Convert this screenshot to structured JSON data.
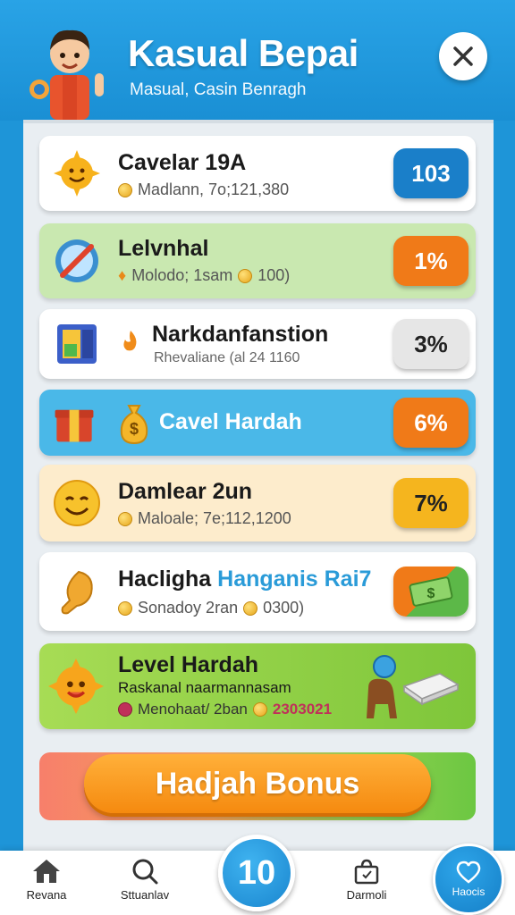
{
  "header": {
    "title": "Kasual Bepai",
    "subtitle": "Masual, Casin Benragh",
    "close_icon": "close-icon"
  },
  "rows": [
    {
      "title": "Cavelar 19A",
      "sub": "Madlann, 7o;121,380",
      "badge": "103",
      "badge_color": "#1a7fc9",
      "bg": "#ffffff",
      "icon": "smiling-sun-icon"
    },
    {
      "title": "Lelvnhal",
      "sub": "Molodo; 1sam",
      "sub2": "100)",
      "badge": "1%",
      "badge_color": "#f07a18",
      "bg": "#c9e8b0",
      "icon": "crossed-compass-icon"
    },
    {
      "title": "Narkdanfanstion",
      "sub": "Rhevaliane (al 24 1160",
      "badge": "3%",
      "badge_color": "#e6e6e6",
      "bg": "#ffffff",
      "icon": "window-frame-icon"
    },
    {
      "title": "Cavel Hardah",
      "badge": "6%",
      "badge_color": "#f07a18",
      "bg": "#4ab8e8",
      "icon": "gift-box-icon"
    },
    {
      "title": "Damlear 2un",
      "sub": "Maloale; 7e;112,1200",
      "badge": "7%",
      "badge_color": "#f5b51e",
      "bg": "#fdeccc",
      "icon": "smiley-face-icon"
    },
    {
      "title": "Hacligha",
      "title_accent": "Hanganis Rai7",
      "sub": "Sonadoy 2ran",
      "sub2": "0300)",
      "bg": "#ffffff",
      "icon": "chicken-leg-icon",
      "badge_icon": "cash-bundle-icon"
    },
    {
      "title": "Level Hardah",
      "sub": "Raskanal naarmannasam",
      "sub3": "Menohaat/ 2ban",
      "sub4": "2303021",
      "bg": "#9ed84e",
      "icon": "sun-face-icon"
    }
  ],
  "bonus_button": "Hadjah Bonus",
  "nav": {
    "items": [
      {
        "label": "Revana",
        "icon": "home-icon"
      },
      {
        "label": "Sttuanlav",
        "icon": "search-icon"
      },
      {
        "label": "Darmoli",
        "icon": "bag-icon"
      },
      {
        "label": "Haocis",
        "icon": "heart-icon"
      }
    ],
    "center_value": "10"
  },
  "colors": {
    "brand_blue": "#1e95d8",
    "accent_orange": "#f58a0f",
    "panel": "#e9eef2"
  }
}
